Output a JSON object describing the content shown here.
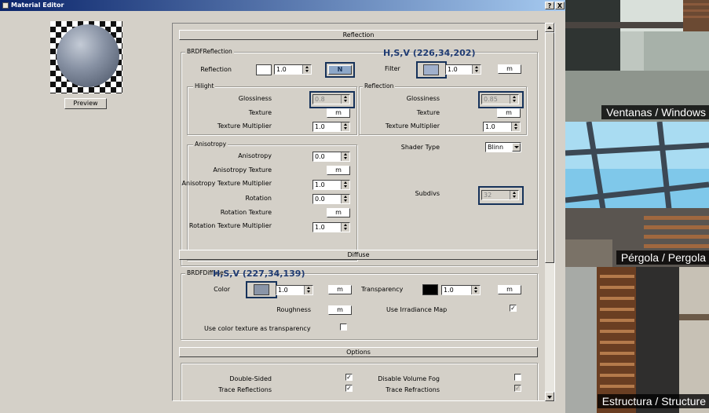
{
  "window": {
    "title": "Material Editor",
    "help_label": "?",
    "close_label": "X"
  },
  "preview": {
    "button_label": "Preview"
  },
  "reflection_section": {
    "header": "Reflection",
    "group_label": "BRDFReflection",
    "reflection_label": "Reflection",
    "reflection_color": "#ffffff",
    "reflection_amount": "1.0",
    "reflection_map_label": "N",
    "filter_label": "Filter",
    "filter_color": "#a0b0cc",
    "filter_amount": "1.0",
    "filter_map_label": "m",
    "hilight": {
      "title": "Hilight",
      "glossiness_label": "Glossiness",
      "glossiness_value": "0.8",
      "texture_label": "Texture",
      "texture_map_label": "m",
      "texture_multiplier_label": "Texture Multiplier",
      "texture_multiplier_value": "1.0"
    },
    "reflection_group": {
      "title": "Reflection",
      "glossiness_label": "Glossiness",
      "glossiness_value": "0.85",
      "texture_label": "Texture",
      "texture_map_label": "m",
      "texture_multiplier_label": "Texture Multiplier",
      "texture_multiplier_value": "1.0"
    },
    "anisotropy": {
      "title": "Anisotropy",
      "anisotropy_label": "Anisotropy",
      "anisotropy_value": "0.0",
      "anisotropy_texture_label": "Anisotropy Texture",
      "anisotropy_texture_map_label": "m",
      "anisotropy_texture_multiplier_label": "Anisotropy Texture Multiplier",
      "anisotropy_texture_multiplier_value": "1.0",
      "rotation_label": "Rotation",
      "rotation_value": "0.0",
      "rotation_texture_label": "Rotation Texture",
      "rotation_texture_map_label": "m",
      "rotation_texture_multiplier_label": "Rotation Texture Multiplier",
      "rotation_texture_multiplier_value": "1.0"
    },
    "shader_type_label": "Shader Type",
    "shader_type_value": "Blinn",
    "subdivs_label": "Subdivs",
    "subdivs_value": "32"
  },
  "diffuse_section": {
    "header": "Diffuse",
    "group_label": "BRDFDiffuse",
    "color_label": "Color",
    "color_swatch": "#8a95a8",
    "color_amount": "1.0",
    "color_map_label": "m",
    "transparency_label": "Transparency",
    "transparency_color": "#000000",
    "transparency_amount": "1.0",
    "transparency_map_label": "m",
    "roughness_label": "Roughness",
    "roughness_map_label": "m",
    "use_irradiance_label": "Use Irradiance Map",
    "use_irradiance_checked": true,
    "use_color_texture_label": "Use color texture as transparency",
    "use_color_texture_checked": false
  },
  "options_section": {
    "header": "Options",
    "items": [
      {
        "label": "Double-Sided",
        "checked": true
      },
      {
        "label": "Disable Volume Fog",
        "checked": false
      },
      {
        "label": "Trace Reflections",
        "checked": true
      },
      {
        "label": "Trace Refractions",
        "checked": true
      }
    ]
  },
  "annotations": {
    "filter_hsv": "H,S,V (226,34,202)",
    "diffuse_hsv": "H,S,V (227,34,139)"
  },
  "captions": {
    "windows": "Ventanas / Windows",
    "pergola": "Pérgola / Pergola",
    "structure": "Estructura / Structure"
  }
}
